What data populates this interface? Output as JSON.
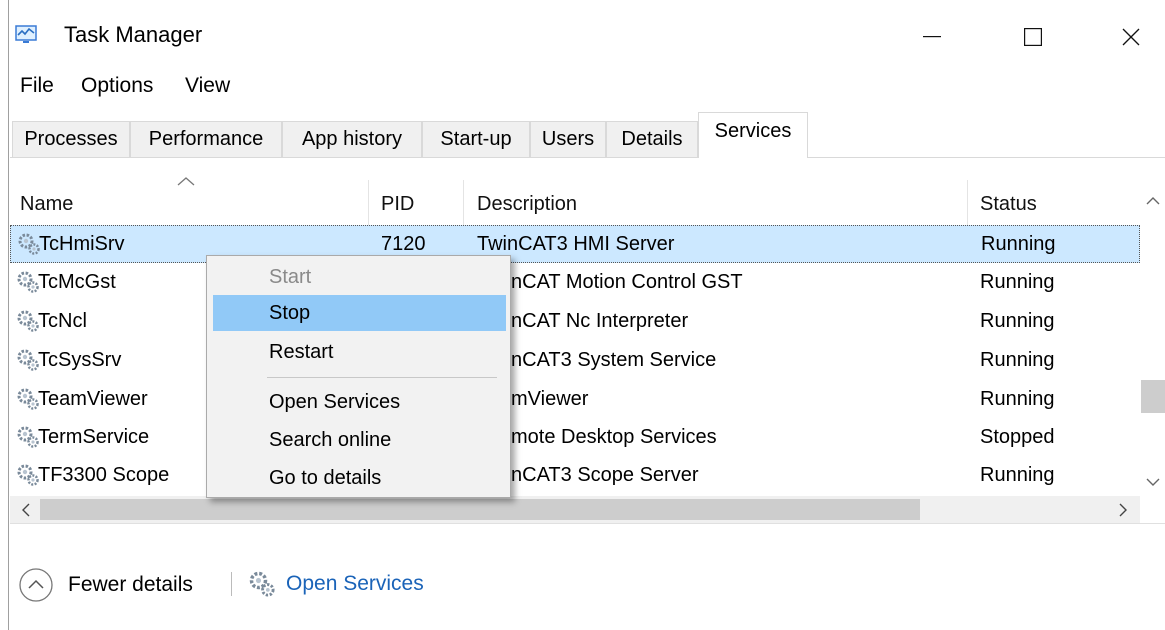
{
  "window": {
    "title": "Task Manager",
    "controls": {
      "minimize": "—",
      "maximize": "☐",
      "close": "✕"
    }
  },
  "menu": {
    "file": "File",
    "options": "Options",
    "view": "View"
  },
  "tabs": [
    {
      "label": "Processes"
    },
    {
      "label": "Performance"
    },
    {
      "label": "App history"
    },
    {
      "label": "Start-up"
    },
    {
      "label": "Users"
    },
    {
      "label": "Details"
    },
    {
      "label": "Services",
      "active": true
    }
  ],
  "table": {
    "columns": {
      "name": "Name",
      "pid": "PID",
      "description": "Description",
      "status": "Status"
    },
    "rows": [
      {
        "name": "TcHmiSrv",
        "pid": "7120",
        "description": "TwinCAT3 HMI Server",
        "status": "Running",
        "selected": true
      },
      {
        "name": "TcMcGst",
        "pid": "",
        "description": "nCAT Motion Control GST",
        "status": "Running"
      },
      {
        "name": "TcNcl",
        "pid": "",
        "description": "nCAT Nc Interpreter",
        "status": "Running"
      },
      {
        "name": "TcSysSrv",
        "pid": "",
        "description": "nCAT3 System Service",
        "status": "Running"
      },
      {
        "name": "TeamViewer",
        "pid": "",
        "description": "mViewer",
        "status": "Running"
      },
      {
        "name": "TermService",
        "pid": "",
        "description": "mote Desktop Services",
        "status": "Stopped"
      },
      {
        "name": "TF3300 Scope ",
        "pid": "",
        "description": "nCAT3 Scope Server",
        "status": "Running"
      }
    ]
  },
  "context_menu": {
    "items": [
      {
        "label": "Start",
        "state": "disabled"
      },
      {
        "label": "Stop",
        "state": "hover"
      },
      {
        "label": "Restart",
        "state": "normal"
      },
      {
        "label": "Open Services",
        "state": "normal"
      },
      {
        "label": "Search online",
        "state": "normal"
      },
      {
        "label": "Go to details",
        "state": "normal"
      }
    ]
  },
  "footer": {
    "fewer_details": "Fewer details",
    "open_services": "Open Services"
  },
  "icons": {
    "app": "task-manager-icon",
    "service": "service-gear-icon",
    "fewer": "chevron-up-circle-icon"
  },
  "colors": {
    "selection": "#cce8ff",
    "menu_hover": "#91c9f7",
    "link": "#1a63b8"
  }
}
